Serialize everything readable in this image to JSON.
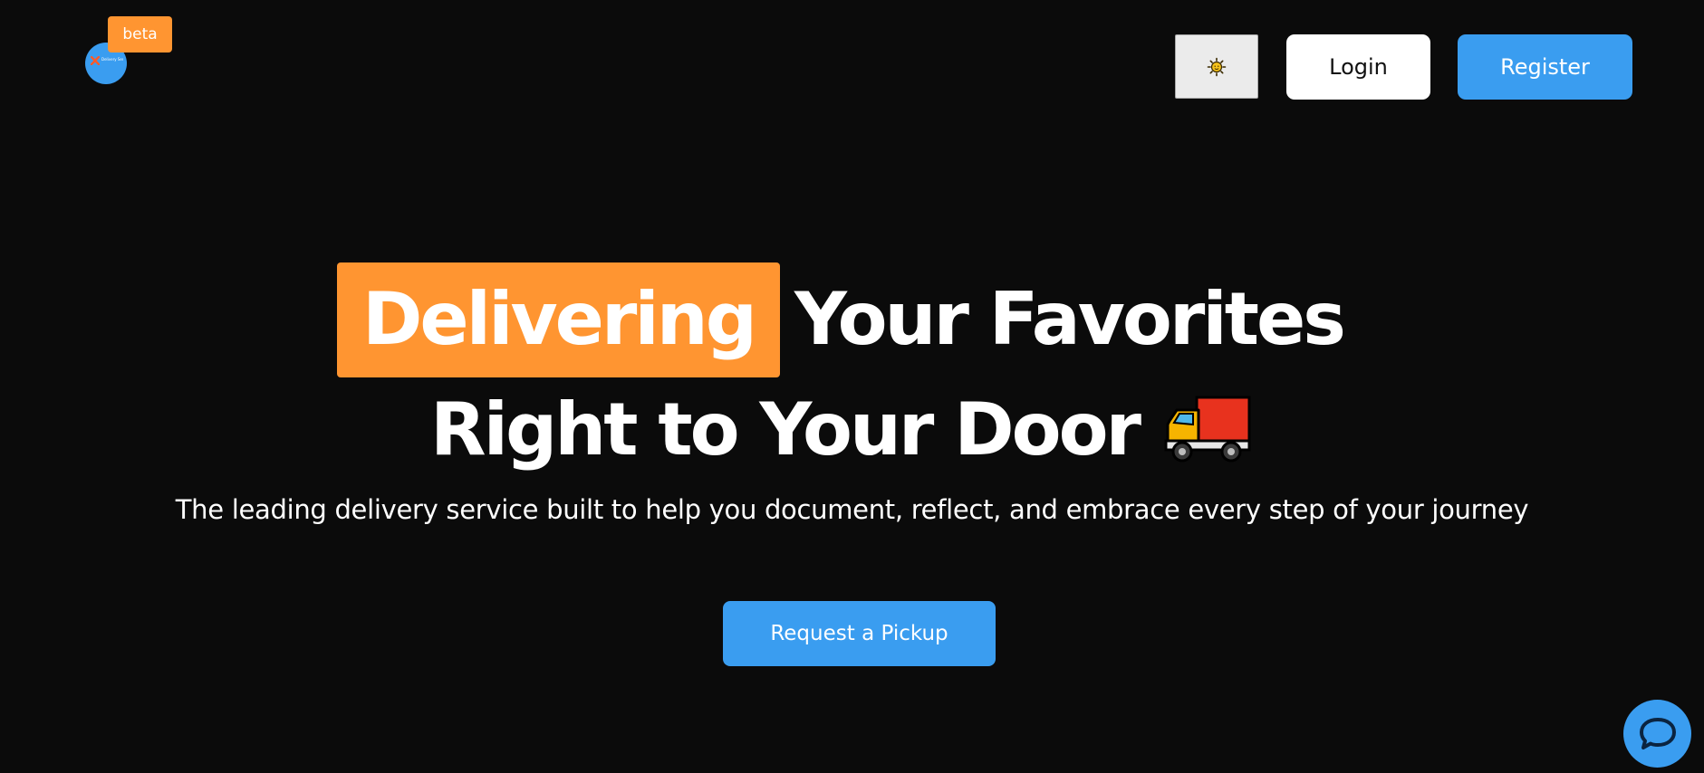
{
  "header": {
    "logo_text": "Delivery Service",
    "beta_badge": "beta",
    "theme_toggle_icon": "sun-icon",
    "login_label": "Login",
    "register_label": "Register"
  },
  "hero": {
    "highlight_word": "Delivering",
    "line1_rest": "Your Favorites",
    "line2": "Right to Your Door",
    "line2_icon": "delivery-truck-icon",
    "subtitle": "The leading delivery service built to help you document, reflect, and embrace every step of your journey",
    "cta_label": "Request a Pickup"
  },
  "chat": {
    "icon": "chat-bubble-icon"
  },
  "colors": {
    "background": "#0b0b0b",
    "accent_orange": "#ff9531",
    "accent_blue": "#3a9df0",
    "text": "#ffffff"
  }
}
